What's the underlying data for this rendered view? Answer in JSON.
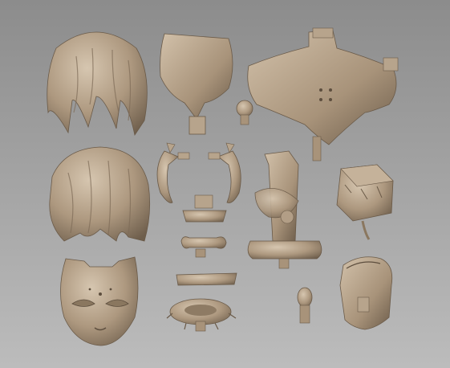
{
  "scene": {
    "description_hidden": "",
    "colors": {
      "background_top": "#8a8a8a",
      "background_bottom": "#b9b9b9",
      "clay_light": "#c9b7a0",
      "clay_mid": "#a8947c",
      "clay_dark": "#6f5f4d",
      "clay_shadow": "#5a4c3e"
    },
    "parts": [
      {
        "id": "hair-front",
        "kind": "sculpt-part"
      },
      {
        "id": "hair-back",
        "kind": "sculpt-part"
      },
      {
        "id": "face-mask",
        "kind": "sculpt-part"
      },
      {
        "id": "skirt-piece",
        "kind": "sculpt-part"
      },
      {
        "id": "small-ornament",
        "kind": "sculpt-part"
      },
      {
        "id": "torso-bust",
        "kind": "sculpt-part"
      },
      {
        "id": "left-arm-strap",
        "kind": "sculpt-part"
      },
      {
        "id": "right-arm-strap",
        "kind": "sculpt-part"
      },
      {
        "id": "connector-block",
        "kind": "sculpt-part"
      },
      {
        "id": "scroll-band",
        "kind": "sculpt-part"
      },
      {
        "id": "ribbon-band",
        "kind": "sculpt-part"
      },
      {
        "id": "floral-wreath",
        "kind": "sculpt-part"
      },
      {
        "id": "statue-pillar",
        "kind": "sculpt-part"
      },
      {
        "id": "treasure-chest",
        "kind": "sculpt-part"
      },
      {
        "id": "pine-ornament",
        "kind": "sculpt-part"
      },
      {
        "id": "ornate-shield",
        "kind": "sculpt-part"
      }
    ]
  }
}
